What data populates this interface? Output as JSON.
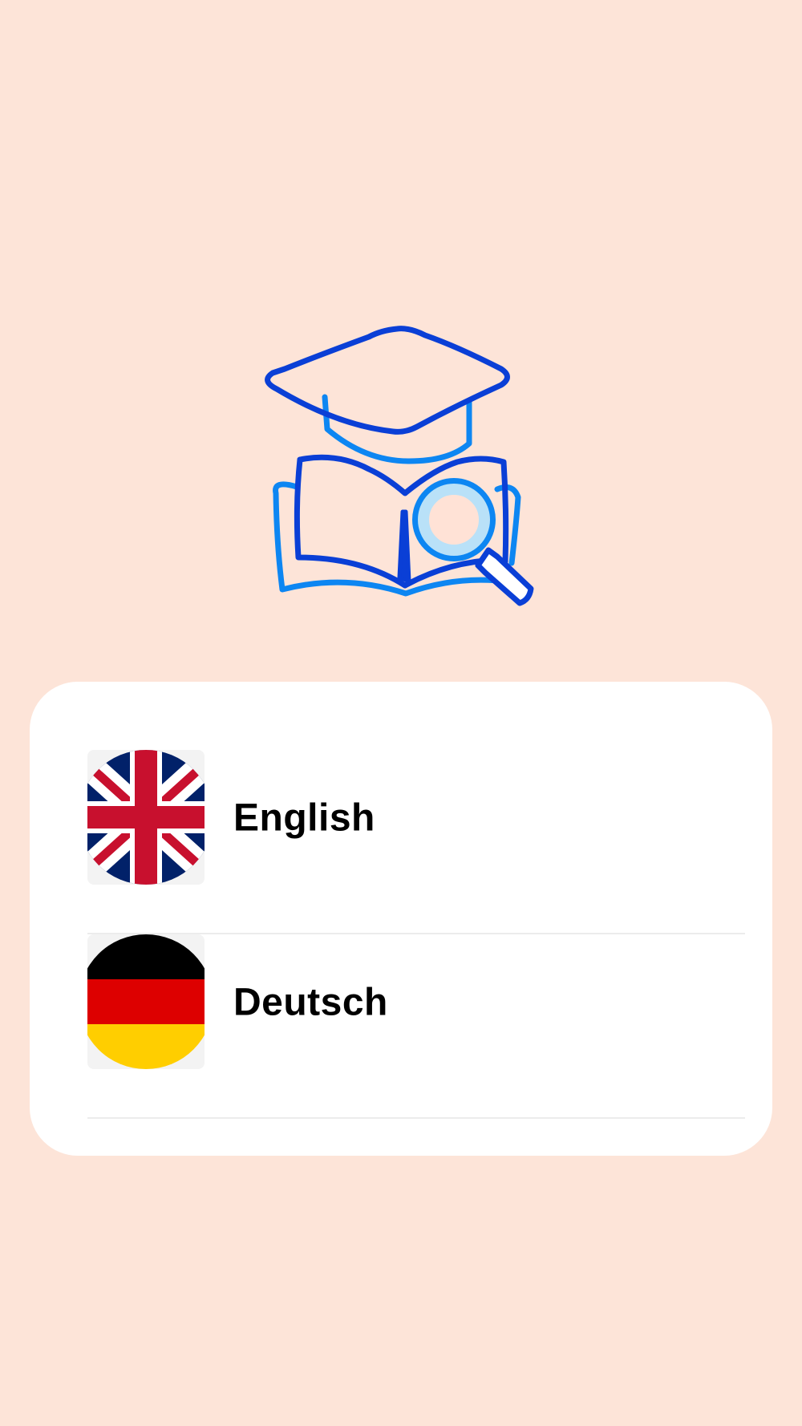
{
  "languages": [
    {
      "label": "English",
      "flag": "uk-flag-icon"
    },
    {
      "label": "Deutsch",
      "flag": "germany-flag-icon"
    }
  ],
  "colors": {
    "background": "#fde4d8",
    "card": "#ffffff",
    "icon_dark_blue": "#0a3fd6",
    "icon_light_blue": "#0d86f2"
  },
  "hero_icon": "graduation-book-search-icon"
}
